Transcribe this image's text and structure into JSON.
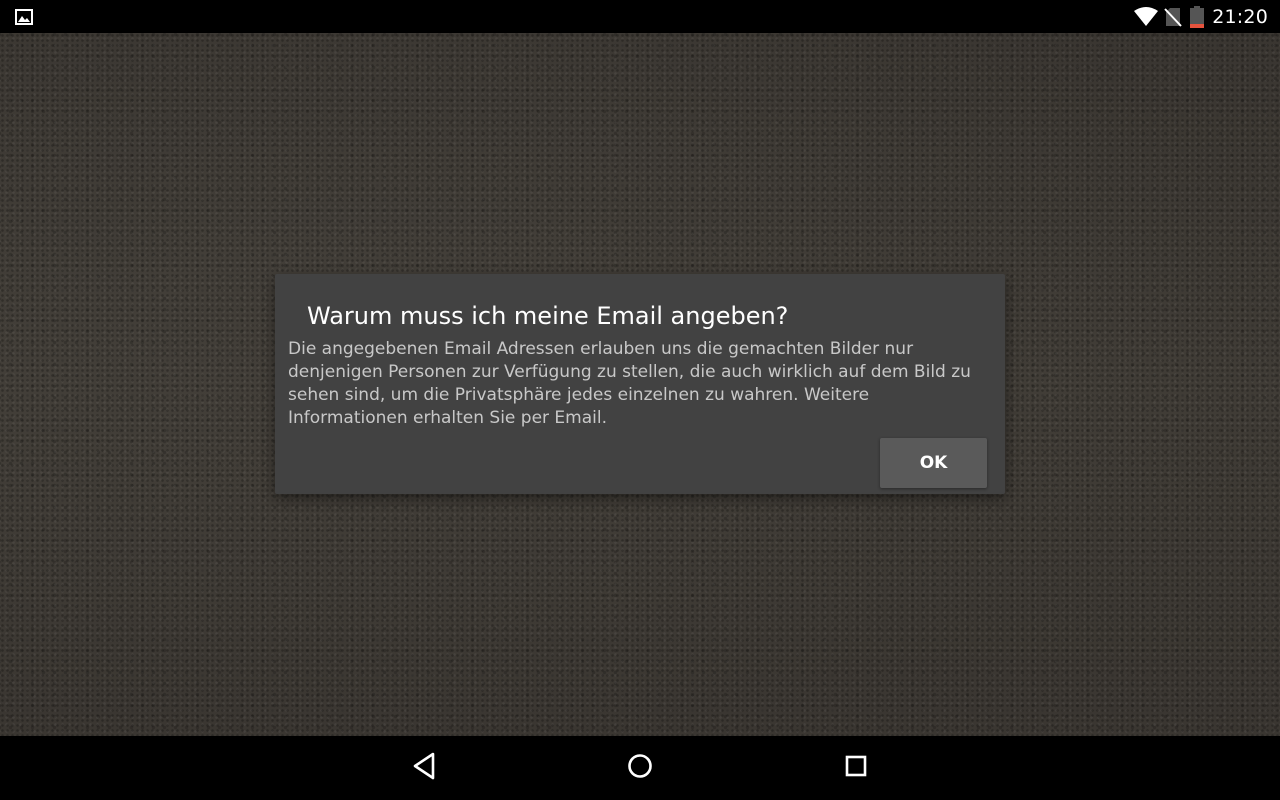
{
  "status_bar": {
    "time": "21:20",
    "left_icon": "image-notification-icon",
    "right_icons": [
      "wifi-icon",
      "no-sim-icon",
      "battery-low-icon"
    ]
  },
  "dialog": {
    "title": "Warum muss ich meine Email angeben?",
    "message": "Die angegebenen Email Adressen erlauben uns die gemachten Bilder nur denjenigen Personen zur Verfügung zu stellen, die auch wirklich auf dem Bild zu sehen sind, um die Privatsphäre jedes einzelnen zu wahren. Weitere Informationen erhalten Sie per Email.",
    "ok_label": "OK"
  },
  "nav_bar": {
    "icons": [
      "back-icon",
      "home-icon",
      "recents-icon"
    ]
  },
  "colors": {
    "dialog_background": "#424242",
    "button_background": "#5a5a5a",
    "battery_level": "#e5533d"
  }
}
